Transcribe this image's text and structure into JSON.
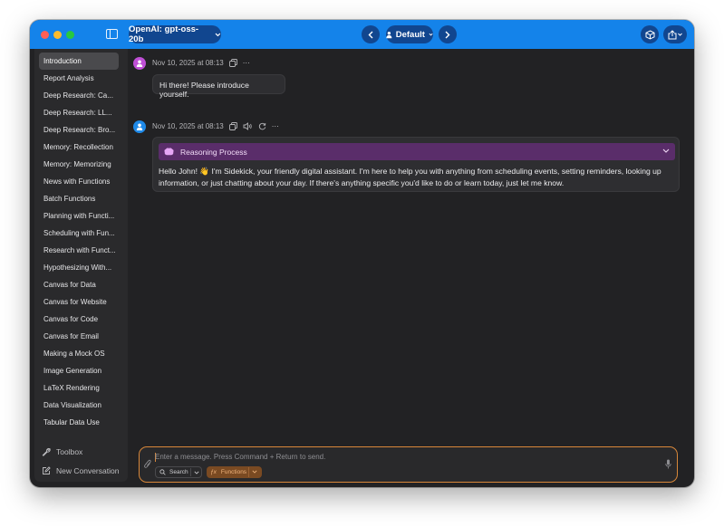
{
  "window": {
    "model_label": "OpenAI: gpt-oss-20b",
    "profile_label": "Default"
  },
  "sidebar": {
    "items": [
      {
        "label": "Introduction",
        "active": true
      },
      {
        "label": "Report Analysis"
      },
      {
        "label": "Deep Research: Ca..."
      },
      {
        "label": "Deep Research: LL..."
      },
      {
        "label": "Deep Research: Bro..."
      },
      {
        "label": "Memory: Recollection"
      },
      {
        "label": "Memory: Memorizing"
      },
      {
        "label": "News with Functions"
      },
      {
        "label": "Batch Functions"
      },
      {
        "label": "Planning with Functi..."
      },
      {
        "label": "Scheduling with Fun..."
      },
      {
        "label": "Research with Funct..."
      },
      {
        "label": "Hypothesizing With..."
      },
      {
        "label": "Canvas for Data"
      },
      {
        "label": "Canvas for Website"
      },
      {
        "label": "Canvas for Code"
      },
      {
        "label": "Canvas for Email"
      },
      {
        "label": "Making a Mock OS"
      },
      {
        "label": "Image Generation"
      },
      {
        "label": "LaTeX Rendering"
      },
      {
        "label": "Data Visualization"
      },
      {
        "label": "Tabular Data Use"
      }
    ],
    "toolbox_label": "Toolbox",
    "new_conversation_label": "New Conversation"
  },
  "conversation": {
    "user_message": {
      "timestamp": "Nov 10, 2025 at 08:13",
      "text": "Hi there! Please introduce yourself."
    },
    "assistant_message": {
      "timestamp": "Nov 10, 2025 at 08:13",
      "reasoning_label": "Reasoning Process",
      "text": "Hello John! 👋 I'm Sidekick, your friendly digital assistant. I'm here to help you with anything from scheduling events, setting reminders, looking up information, or just chatting about your day. If there's anything specific you'd like to do or learn today, just let me know."
    }
  },
  "composer": {
    "placeholder": "Enter a message. Press Command + Return to send.",
    "search_label": "Search",
    "functions_label": "Functions"
  },
  "colors": {
    "accent": "#1483ea",
    "composer_border": "#d8873a",
    "reasoning_bg": "#5a2d6a",
    "user_avatar": "#c04fd6",
    "assistant_avatar": "#1f8ae8"
  }
}
